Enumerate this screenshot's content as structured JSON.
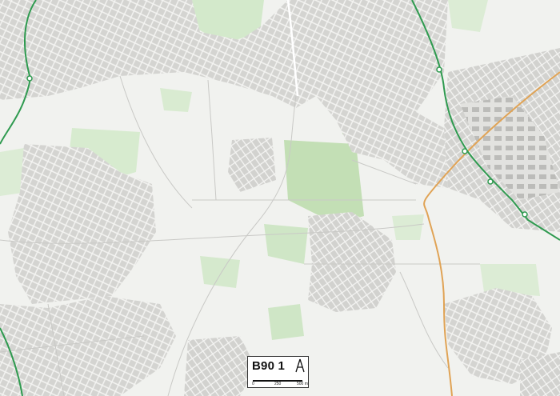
{
  "map": {
    "postcode_label": "B90 1",
    "scale": {
      "start": "0",
      "mid": "250",
      "end": "500 m"
    },
    "north_icon": "north-arrow-icon",
    "colors": {
      "background": "#f1f2ef",
      "built_up": "#d9d9d6",
      "road": "#ffffff",
      "road_casing": "#b7b7b4",
      "green_space": "#cfe6c6",
      "field_green": "#bfdcb0",
      "railway": "#2e9a4f",
      "main_road": "#e3a65a"
    }
  }
}
